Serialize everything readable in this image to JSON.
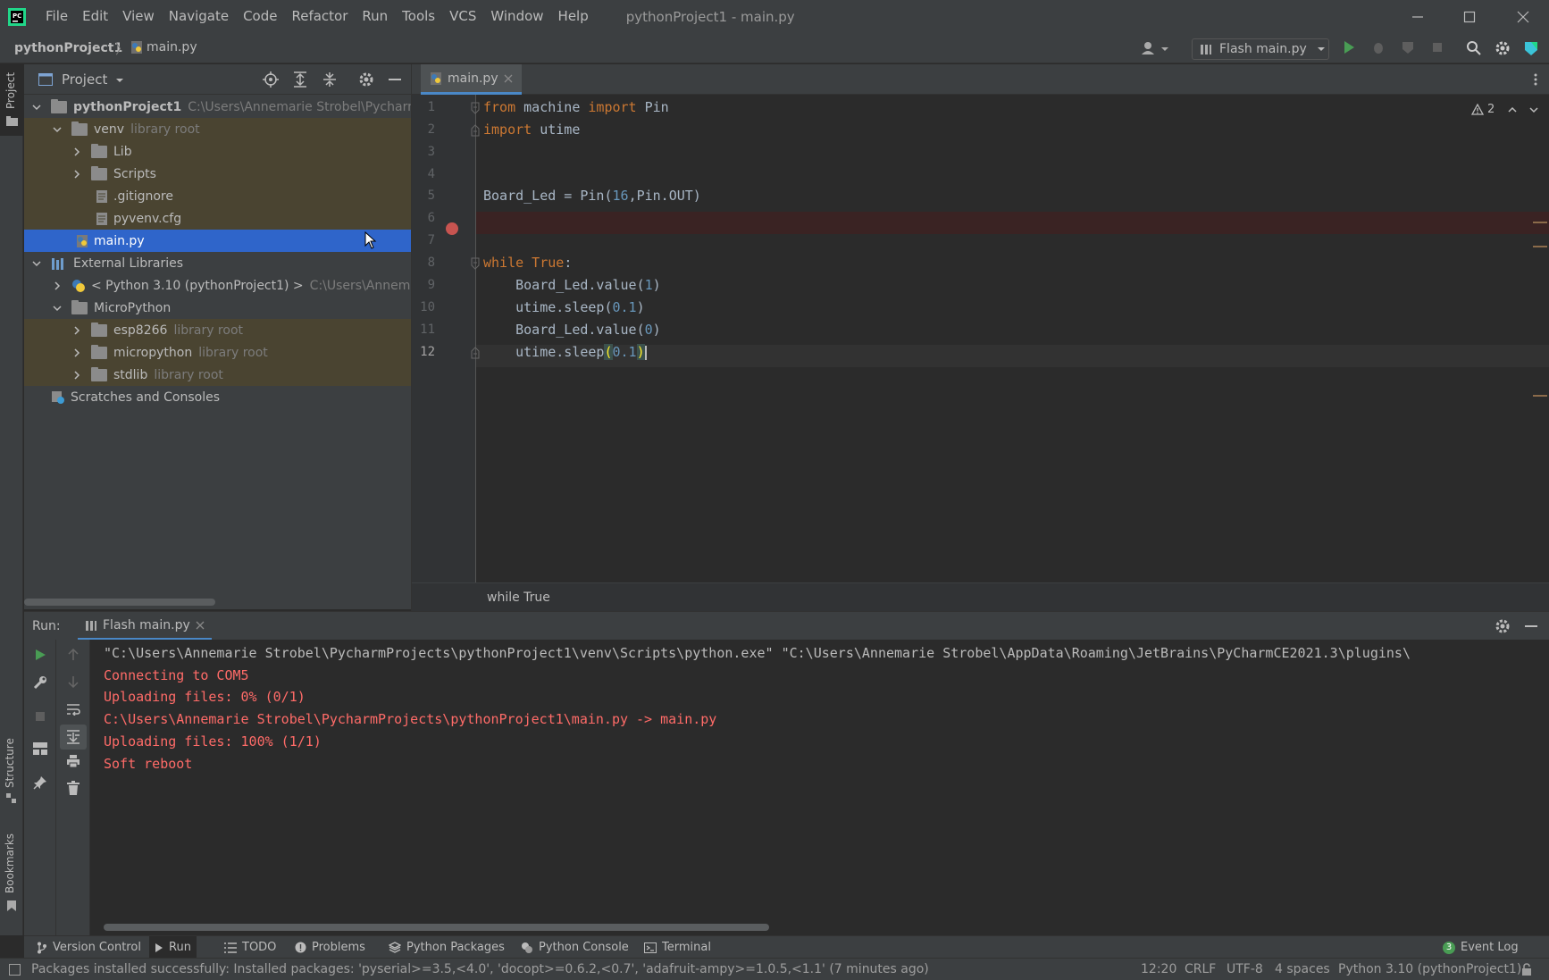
{
  "app": {
    "window_title": "pythonProject1 - main.py",
    "menu": [
      "File",
      "Edit",
      "View",
      "Navigate",
      "Code",
      "Refactor",
      "Run",
      "Tools",
      "VCS",
      "Window",
      "Help"
    ]
  },
  "navbar": {
    "project": "pythonProject1",
    "file": "main.py",
    "run_config": "Flash main.py"
  },
  "left_strip": {
    "project_label": "Project",
    "structure_label": "Structure",
    "bookmarks_label": "Bookmarks"
  },
  "project_panel": {
    "title": "Project",
    "tree": [
      {
        "label": "pythonProject1",
        "hint": "C:\\Users\\Annemarie Strobel\\PycharmPro",
        "bold": true
      },
      {
        "label": "venv",
        "hint": "library root"
      },
      {
        "label": "Lib",
        "hint": ""
      },
      {
        "label": "Scripts",
        "hint": ""
      },
      {
        "label": ".gitignore",
        "hint": ""
      },
      {
        "label": "pyvenv.cfg",
        "hint": ""
      },
      {
        "label": "main.py",
        "hint": ""
      },
      {
        "label": "External Libraries",
        "hint": ""
      },
      {
        "label": "< Python 3.10 (pythonProject1) >",
        "hint": "C:\\Users\\Annemarie"
      },
      {
        "label": "MicroPython",
        "hint": ""
      },
      {
        "label": "esp8266",
        "hint": "library root"
      },
      {
        "label": "micropython",
        "hint": "library root"
      },
      {
        "label": "stdlib",
        "hint": "library root"
      },
      {
        "label": "Scratches and Consoles",
        "hint": ""
      }
    ]
  },
  "editor": {
    "tab_label": "main.py",
    "warning_count": "2",
    "line_numbers": [
      "1",
      "2",
      "3",
      "4",
      "5",
      "6",
      "7",
      "8",
      "9",
      "10",
      "11",
      "12"
    ],
    "lines": {
      "l1_kw1": "from",
      "l1_mid": " machine ",
      "l1_kw2": "import",
      "l1_end": " Pin",
      "l2_kw": "import",
      "l2_end": " utime",
      "l5_a": "Board_Led = Pin(",
      "l5_num": "16",
      "l5_b": ",Pin.OUT)",
      "l8_kw1": "while",
      "l8_kw2": " True",
      "l8_end": ":",
      "l9_a": "    Board_Led.value(",
      "l9_num": "1",
      "l9_b": ")",
      "l10_a": "    utime.sleep(",
      "l10_num": "0.1",
      "l10_b": ")",
      "l11_a": "    Board_Led.value(",
      "l11_num": "0",
      "l11_b": ")",
      "l12_a": "    utime.sleep",
      "l12_p1": "(",
      "l12_num": "0.1",
      "l12_p2": ")"
    },
    "breadcrumb": "while True"
  },
  "run_panel": {
    "label": "Run:",
    "tab_label": "Flash main.py",
    "output": [
      {
        "text": "\"C:\\Users\\Annemarie Strobel\\PycharmProjects\\pythonProject1\\venv\\Scripts\\python.exe\" \"C:\\Users\\Annemarie Strobel\\AppData\\Roaming\\JetBrains\\PyCharmCE2021.3\\plugins\\",
        "color": "#bbbbbb"
      },
      {
        "text": "Connecting to COM5",
        "color": "#ff6b68"
      },
      {
        "text": "Uploading files: 0% (0/1)",
        "color": "#ff6b68"
      },
      {
        "text": "C:\\Users\\Annemarie Strobel\\PycharmProjects\\pythonProject1\\main.py -> main.py",
        "color": "#ff6b68"
      },
      {
        "text": "Uploading files: 100% (1/1)",
        "color": "#ff6b68"
      },
      {
        "text": "Soft reboot",
        "color": "#ff6b68"
      }
    ]
  },
  "bottom_tools": {
    "version_control": "Version Control",
    "run": "Run",
    "todo": "TODO",
    "problems": "Problems",
    "python_packages": "Python Packages",
    "python_console": "Python Console",
    "terminal": "Terminal",
    "event_log": "Event Log",
    "event_log_count": "3"
  },
  "status": {
    "message": "Packages installed successfully: Installed packages: 'pyserial>=3.5,<4.0', 'docopt>=0.6.2,<0.7', 'adafruit-ampy>=1.0.5,<1.1' (7 minutes ago)",
    "position": "12:20",
    "line_sep": "CRLF",
    "encoding": "UTF-8",
    "indent": "4 spaces",
    "interpreter": "Python 3.10 (pythonProject1)"
  },
  "colors": {
    "accent": "#4a88c7",
    "selection": "#2f65ca",
    "error_text": "#ff6b68",
    "keyword": "#cc7832",
    "number": "#6897bb",
    "breakpoint": "#c75450"
  }
}
